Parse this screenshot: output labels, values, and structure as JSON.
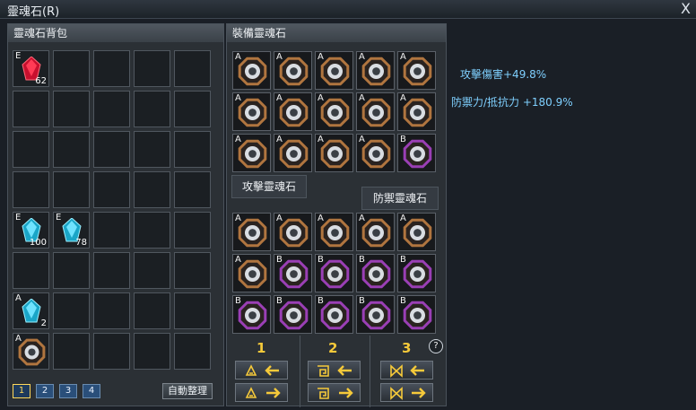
{
  "window": {
    "title": "靈魂石(R)",
    "close_label": "X"
  },
  "bag": {
    "header": "靈魂石背包",
    "items": [
      {
        "row": 0,
        "col": 0,
        "grade": "E",
        "type": "red-gem",
        "count": "62"
      },
      {
        "row": 4,
        "col": 0,
        "grade": "E",
        "type": "blue-gem",
        "count": "100"
      },
      {
        "row": 4,
        "col": 1,
        "grade": "E",
        "type": "blue-gem",
        "count": "78"
      },
      {
        "row": 6,
        "col": 0,
        "grade": "A",
        "type": "blue-gem",
        "count": "2"
      },
      {
        "row": 7,
        "col": 0,
        "grade": "A",
        "type": "bronze-dragon-stone",
        "count": ""
      }
    ],
    "pages": [
      "1",
      "2",
      "3",
      "4"
    ],
    "active_page": "1",
    "sort_label": "自動整理"
  },
  "equip": {
    "header": "裝備靈魂石",
    "attack_grades": [
      "A",
      "A",
      "A",
      "A",
      "A",
      "A",
      "A",
      "A",
      "A",
      "A",
      "A",
      "A",
      "A",
      "A",
      "B"
    ],
    "attack_types": [
      "bronze",
      "bronze",
      "bronze",
      "bronze",
      "bronze",
      "bronze",
      "bronze",
      "bronze",
      "bronze",
      "bronze",
      "bronze",
      "bronze",
      "bronze",
      "bronze",
      "purple"
    ],
    "attack_tab": "攻擊靈魂石",
    "defense_tab": "防禦靈魂石",
    "defense_grades": [
      "A",
      "A",
      "A",
      "A",
      "A",
      "A",
      "B",
      "B",
      "B",
      "B",
      "B",
      "B",
      "B",
      "B",
      "B"
    ],
    "defense_types": [
      "bronze",
      "bronze",
      "bronze",
      "bronze",
      "bronze",
      "bronze",
      "purple",
      "purple",
      "purple",
      "purple",
      "purple",
      "purple",
      "purple",
      "purple",
      "purple"
    ],
    "sets": [
      {
        "number": "1",
        "icon": "triangle-icon"
      },
      {
        "number": "2",
        "icon": "spiral-icon"
      },
      {
        "number": "3",
        "icon": "bowtie-icon"
      }
    ],
    "help_label": "?"
  },
  "stats": {
    "attack": "攻擊傷害+49.8%",
    "defense": "防禦力/抵抗力 +180.9%"
  },
  "colors": {
    "accent": "#f5c93a",
    "stat_text": "#7fd0ff",
    "purple_frame": "#9a3fb5",
    "bronze_frame": "#b0753f"
  }
}
